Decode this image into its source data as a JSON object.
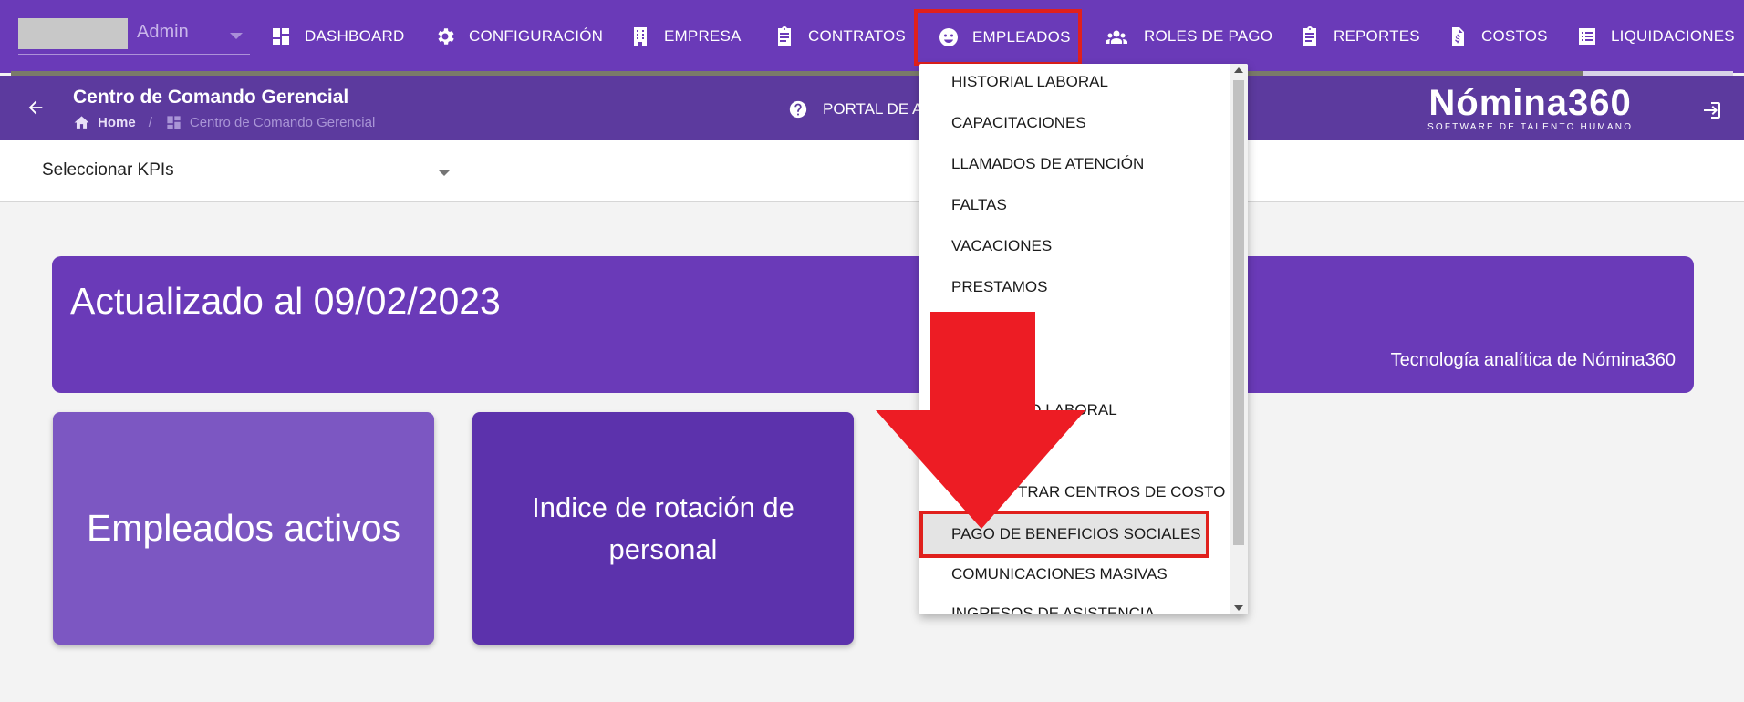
{
  "user": {
    "name": "Admin"
  },
  "nav": [
    {
      "id": "dashboard",
      "label": "DASHBOARD",
      "icon": "dashboard-icon"
    },
    {
      "id": "configuracion",
      "label": "CONFIGURACIÓN",
      "icon": "gear-icon"
    },
    {
      "id": "empresa",
      "label": "EMPRESA",
      "icon": "building-icon"
    },
    {
      "id": "contratos",
      "label": "CONTRATOS",
      "icon": "clipboard-icon"
    },
    {
      "id": "empleados",
      "label": "EMPLEADOS",
      "icon": "face-icon",
      "active": true
    },
    {
      "id": "roles",
      "label": "ROLES DE PAGO",
      "icon": "people-icon"
    },
    {
      "id": "reportes",
      "label": "REPORTES",
      "icon": "clipboard-icon"
    },
    {
      "id": "costos",
      "label": "COSTOS",
      "icon": "invoice-dollar-icon"
    },
    {
      "id": "liquidaciones",
      "label": "LIQUIDACIONES",
      "icon": "list-icon"
    }
  ],
  "subheader": {
    "title": "Centro de Comando Gerencial",
    "breadcrumb_home": "Home",
    "breadcrumb_current": "Centro de Comando Gerencial",
    "portal_label": "PORTAL DE A",
    "logo_main": "Nómina360",
    "logo_sub": "SOFTWARE DE TALENTO HUMANO"
  },
  "kpi_select": {
    "value": "Seleccionar KPIs"
  },
  "banner": {
    "title": "Actualizado al 09/02/2023",
    "tagline": "Tecnología analítica de Nómina360"
  },
  "cards": [
    {
      "label": "Empleados activos"
    },
    {
      "label": "Indice de rotación de personal"
    }
  ],
  "empleados_menu": [
    {
      "label": "HISTORIAL LABORAL"
    },
    {
      "label": "CAPACITACIONES"
    },
    {
      "label": "LLAMADOS DE ATENCIÓN"
    },
    {
      "label": "FALTAS"
    },
    {
      "label": "VACACIONES"
    },
    {
      "label": "PRESTAMOS"
    },
    {
      "label": ""
    },
    {
      "label": ""
    },
    {
      "label": "DO LABORAL"
    },
    {
      "label": ""
    },
    {
      "label": "TRAR CENTROS DE COSTO"
    },
    {
      "label": "PAGO DE BENEFICIOS SOCIALES",
      "highlight": true
    },
    {
      "label": "COMUNICACIONES MASIVAS"
    },
    {
      "label": "INGRESOS DE ASISTENCIA"
    }
  ],
  "colors": {
    "nav_bg": "#6a3ab8",
    "subheader_bg": "#5c3a9e",
    "highlight_red": "#e0201c",
    "card1_bg": "#7c57c2",
    "card2_bg": "#5c32ac"
  }
}
